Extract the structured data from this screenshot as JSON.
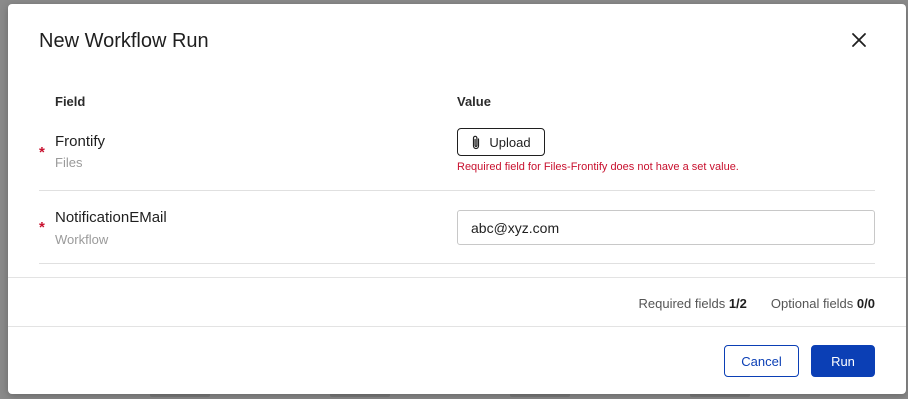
{
  "dialog": {
    "title": "New Workflow Run",
    "close_icon": "close-icon"
  },
  "table": {
    "columns": [
      "Field",
      "Value"
    ]
  },
  "fields": [
    {
      "required": "*",
      "name": "Frontify",
      "source": "Files",
      "upload_label": "Upload",
      "upload_icon": "paperclip-icon",
      "error": "Required field for Files-Frontify does not have a set value."
    },
    {
      "required": "*",
      "name": "NotificationEMail",
      "source": "Workflow",
      "value": "abc@xyz.com"
    }
  ],
  "summary": {
    "required_label": "Required fields",
    "required_count": "1/2",
    "optional_label": "Optional fields",
    "optional_count": "0/0"
  },
  "footer": {
    "cancel_label": "Cancel",
    "run_label": "Run"
  },
  "colors": {
    "primary": "#0b3fb5",
    "error": "#c8102e"
  }
}
